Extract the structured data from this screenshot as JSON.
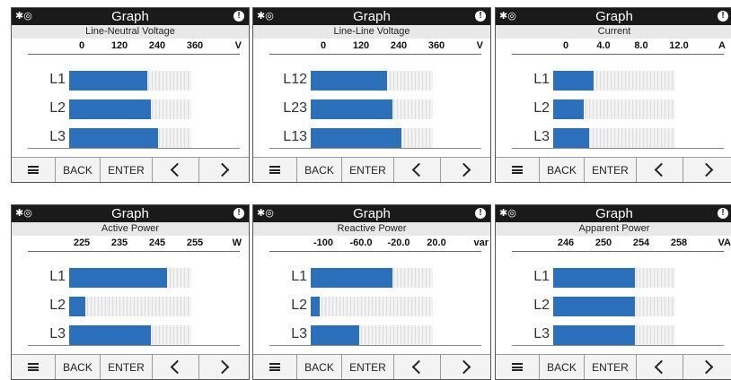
{
  "screens": [
    {
      "title": "Graph",
      "subtitle": "Line-Neutral Voltage",
      "ticks": [
        "0",
        "120",
        "240",
        "360"
      ],
      "unit": "V",
      "axis_range": [
        0,
        360
      ],
      "rows": [
        {
          "label": "L1",
          "value": 230
        },
        {
          "label": "L2",
          "value": 240
        },
        {
          "label": "L3",
          "value": 262
        }
      ],
      "page_count": 6,
      "active_page": 1
    },
    {
      "title": "Graph",
      "subtitle": "Line-Line Voltage",
      "ticks": [
        "0",
        "120",
        "240",
        "360"
      ],
      "unit": "V",
      "axis_range": [
        0,
        360
      ],
      "rows": [
        {
          "label": "L12",
          "value": 225
        },
        {
          "label": "L23",
          "value": 240
        },
        {
          "label": "L13",
          "value": 268
        }
      ],
      "page_count": 6,
      "active_page": 2
    },
    {
      "title": "Graph",
      "subtitle": "Current",
      "ticks": [
        "0",
        "4.0",
        "8.0",
        "12.0"
      ],
      "unit": "A",
      "axis_range": [
        0,
        12
      ],
      "rows": [
        {
          "label": "L1",
          "value": 4.0
        },
        {
          "label": "L2",
          "value": 3.0
        },
        {
          "label": "L3",
          "value": 3.5
        }
      ],
      "page_count": 6,
      "active_page": 3
    },
    {
      "title": "Graph",
      "subtitle": "Active Power",
      "ticks": [
        "225",
        "235",
        "245",
        "255"
      ],
      "unit": "W",
      "axis_range": [
        225,
        255
      ],
      "rows": [
        {
          "label": "L1",
          "value": 249
        },
        {
          "label": "L2",
          "value": 229
        },
        {
          "label": "L3",
          "value": 245
        }
      ],
      "page_count": 6,
      "active_page": 4
    },
    {
      "title": "Graph",
      "subtitle": "Reactive Power",
      "ticks": [
        "-100",
        "-60.0",
        "-20.0",
        "20.0"
      ],
      "unit": "var",
      "axis_range": [
        -100,
        20
      ],
      "rows": [
        {
          "label": "L1",
          "value": -20
        },
        {
          "label": "L2",
          "value": -91
        },
        {
          "label": "L3",
          "value": -52
        }
      ],
      "page_count": 6,
      "active_page": 5
    },
    {
      "title": "Graph",
      "subtitle": "Apparent Power",
      "ticks": [
        "246",
        "250",
        "254",
        "258"
      ],
      "unit": "VA",
      "axis_range": [
        246,
        258
      ],
      "rows": [
        {
          "label": "L1",
          "value": 254
        },
        {
          "label": "L2",
          "value": 254
        },
        {
          "label": "L3",
          "value": 254
        }
      ],
      "page_count": 6,
      "active_page": 6
    }
  ],
  "nav": {
    "back": "BACK",
    "enter": "ENTER"
  },
  "icons": {
    "status_left": "bluetooth-and-signal-icons",
    "status_right": "alert-icon",
    "menu": "menu-icon",
    "prev": "chevron-left-icon",
    "next": "chevron-right-icon"
  },
  "colors": {
    "bar": "#2c6fba",
    "titlebar": "#1a1a1a"
  }
}
